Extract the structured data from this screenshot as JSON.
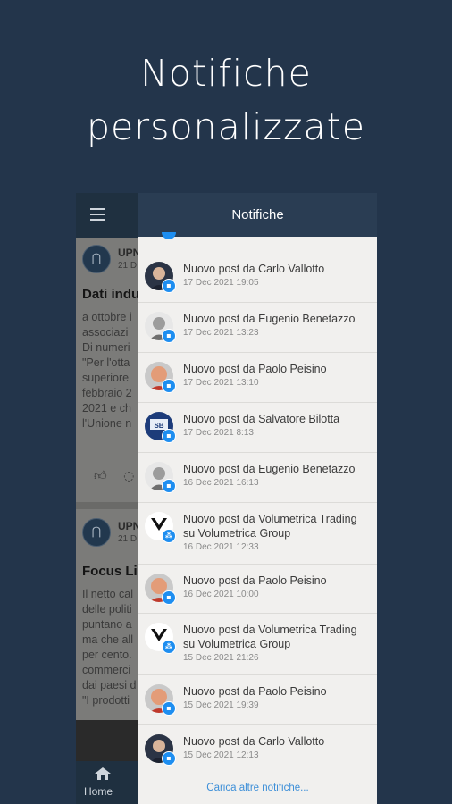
{
  "headline": {
    "line1": "Notifiche",
    "line2": "personalizzate"
  },
  "background_app": {
    "menu_icon": "hamburger-icon",
    "posts": [
      {
        "author": "UPN",
        "date": "21 D",
        "title": "Dati indu",
        "lines": [
          "a ottobre i",
          "associazi",
          "Di numeri",
          "\"Per l'otta",
          "superiore",
          "febbraio 2",
          "2021 e ch",
          "l'Unione n"
        ],
        "actions": [
          "thumbs-up-icon",
          "comment-icon"
        ]
      },
      {
        "author": "UPN",
        "date": "21 D",
        "title": "Focus Lir",
        "lines": [
          "Il netto cal",
          "delle politi",
          "puntano a",
          "ma che all",
          "per cento.",
          "commerci",
          "dai paesi d",
          "\"I prodotti"
        ]
      }
    ],
    "bottom_nav": {
      "home_label": "Home",
      "home_icon": "home-icon"
    }
  },
  "drawer": {
    "title": "Notifiche",
    "notifications": [
      {
        "title": "Nuovo post da Carlo Vallotto",
        "date": "17 Dec 2021 19:05",
        "avatar": "carlo",
        "badge": "page-icon"
      },
      {
        "title": "Nuovo post da Eugenio Benetazzo",
        "date": "17 Dec 2021 13:23",
        "avatar": "eugenio",
        "badge": "page-icon"
      },
      {
        "title": "Nuovo post da Paolo Peisino",
        "date": "17 Dec 2021 13:10",
        "avatar": "paolo",
        "badge": "page-icon"
      },
      {
        "title": "Nuovo post da Salvatore Bilotta",
        "date": "17 Dec 2021 8:13",
        "avatar": "salvatore",
        "badge": "page-icon"
      },
      {
        "title": "Nuovo post da Eugenio Benetazzo",
        "date": "16 Dec 2021 16:13",
        "avatar": "eugenio",
        "badge": "page-icon"
      },
      {
        "title": "Nuovo post da Volumetrica Trading su Volumetrica Group",
        "date": "16 Dec 2021 12:33",
        "avatar": "volumetrica",
        "badge": "group-icon"
      },
      {
        "title": "Nuovo post da Paolo Peisino",
        "date": "16 Dec 2021 10:00",
        "avatar": "paolo",
        "badge": "page-icon"
      },
      {
        "title": "Nuovo post da Volumetrica Trading su Volumetrica Group",
        "date": "15 Dec 2021 21:26",
        "avatar": "volumetrica",
        "badge": "group-icon"
      },
      {
        "title": "Nuovo post da Paolo Peisino",
        "date": "15 Dec 2021 19:39",
        "avatar": "paolo",
        "badge": "page-icon"
      },
      {
        "title": "Nuovo post da Carlo Vallotto",
        "date": "15 Dec 2021 12:13",
        "avatar": "carlo",
        "badge": "page-icon"
      }
    ],
    "load_more": "Carica altre notifiche..."
  },
  "colors": {
    "background": "#23354b",
    "header": "#2a3d53",
    "badge": "#1e8ef0",
    "link": "#3d8fd8"
  }
}
